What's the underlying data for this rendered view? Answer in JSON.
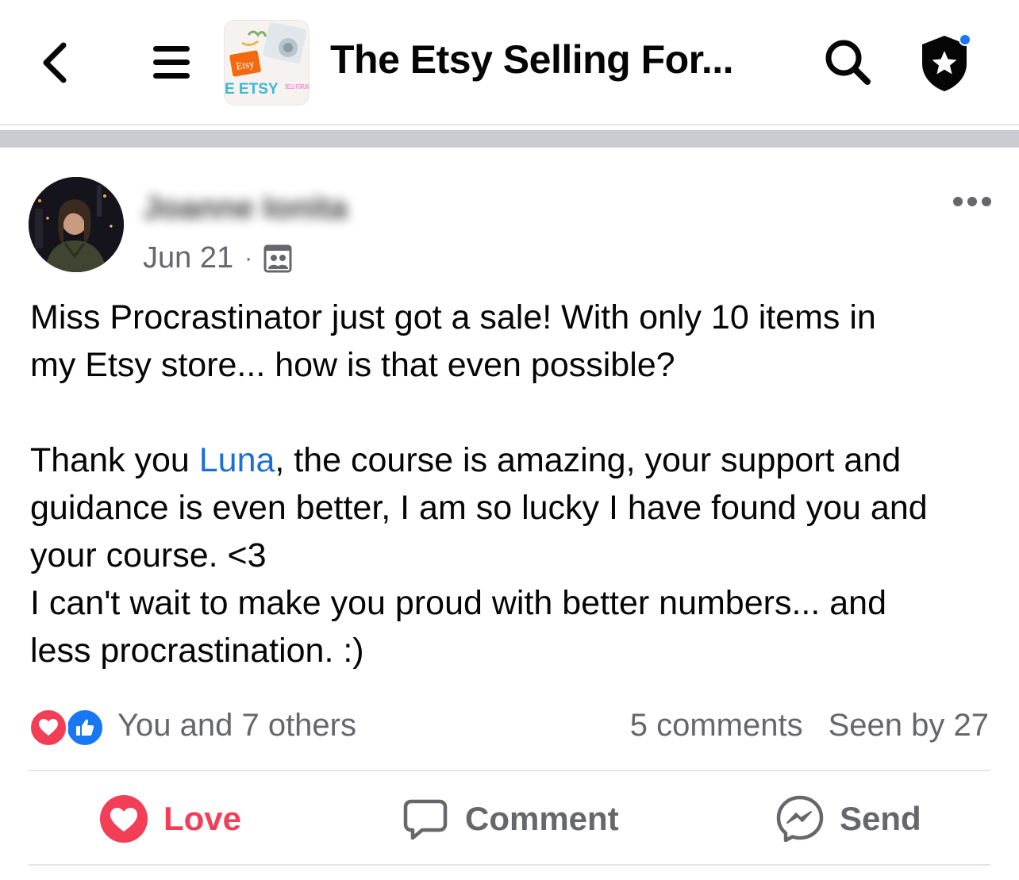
{
  "header": {
    "back_icon": "chevron-left-icon",
    "menu_icon": "hamburger-menu-icon",
    "group_thumbnail": {
      "badge_text": "Etsy",
      "banner_text": "E ETSY",
      "side_text": "SELLI FORUM"
    },
    "group_title": "The Etsy Selling For...",
    "search_icon": "search-icon",
    "admin_icon": "shield-star-icon",
    "notification_dot_color": "#1877f2"
  },
  "post": {
    "author": "Joanne Ionita",
    "date": "Jun 21",
    "separator": "·",
    "audience_icon": "group-members-icon",
    "more_icon": "more-horizontal-icon",
    "body": {
      "line1": "Miss Procrastinator just got a sale! With only 10 items in",
      "line2": "my Etsy store... how is that even possible?",
      "line3_pre": "Thank you ",
      "line3_mention": "Luna",
      "line3_post": ", the course is amazing, your support and",
      "line4": "guidance is even better, I am so lucky I have found you and",
      "line5": "your course. <3",
      "line6": "I can't wait to make you proud with better numbers... and",
      "line7": "less procrastination. :)"
    },
    "reactions": {
      "icons": [
        "love-reaction-icon",
        "like-reaction-icon"
      ],
      "text": "You and 7 others"
    },
    "stats": {
      "comments": "5 comments",
      "seen": "Seen by 27"
    },
    "actions": {
      "love_label": "Love",
      "comment_label": "Comment",
      "send_label": "Send"
    }
  },
  "colors": {
    "love": "#f33e58",
    "like": "#1877f2",
    "mention": "#1d6fd8",
    "secondary_text": "#65676b"
  }
}
